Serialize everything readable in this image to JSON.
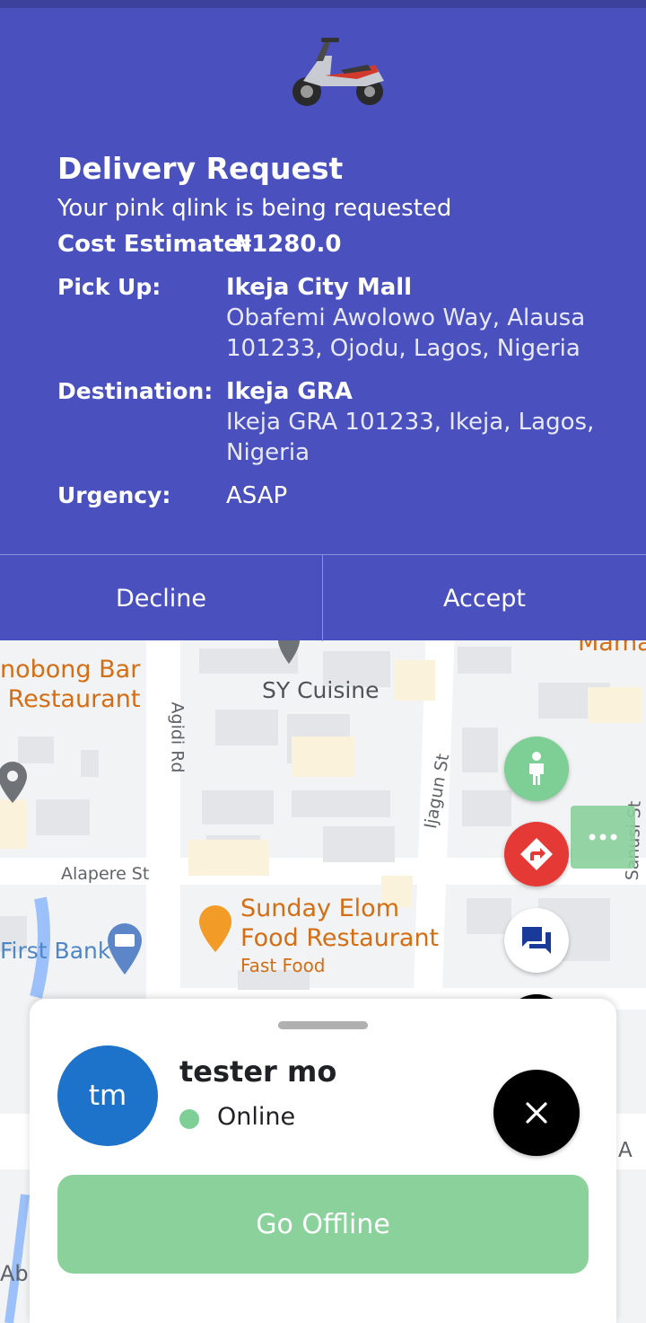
{
  "request": {
    "title": "Delivery Request",
    "subtitle": "Your pink qlink is being requested",
    "cost_label": "Cost Estimate",
    "cost_value": "₦1280.0",
    "pickup_label": "Pick Up:",
    "pickup_name": "Ikeja City Mall",
    "pickup_address_line1": "Obafemi Awolowo Way, Alausa",
    "pickup_address_line2": "101233, Ojodu, Lagos, Nigeria",
    "destination_label": "Destination:",
    "destination_name": "Ikeja GRA",
    "destination_address_line1": "Ikeja GRA 101233, Ikeja, Lagos,",
    "destination_address_line2": "Nigeria",
    "urgency_label": "Urgency:",
    "urgency_value": "ASAP",
    "decline_label": "Decline",
    "accept_label": "Accept"
  },
  "map": {
    "labels": {
      "poi_bar_line1": "nobong Bar",
      "poi_bar_line2": "Restaurant",
      "poi_mama": "Mama",
      "sy_cuisine": "SY Cuisine",
      "agidi_rd": "Agidi Rd",
      "jiagun_st": "Ijagun St",
      "sanusi_st": "Sanusi St",
      "alapere_st": "Alapere St",
      "sunday_line1": "Sunday Elom",
      "sunday_line2": "Food Restaurant",
      "sunday_category": "Fast Food",
      "first_bank": "First Bank",
      "poi_a": "A",
      "poi_ab": "Ab"
    }
  },
  "fabs": {
    "walk_icon": "person-walking-icon",
    "directions_icon": "turn-right-directions-icon",
    "chat_icon": "chat-bubbles-icon",
    "delivery_icon": "delivery-truck-icon",
    "close_icon": "close-icon",
    "more_icon": "more-horizontal-icon",
    "colors": {
      "walk": "#7dcf95",
      "directions": "#e53935",
      "chat": "#ffffff",
      "truck": "#000000",
      "close": "#000000"
    }
  },
  "driver": {
    "initials": "tm",
    "name": "tester mo",
    "status": "Online",
    "go_offline_label": "Go Offline"
  }
}
